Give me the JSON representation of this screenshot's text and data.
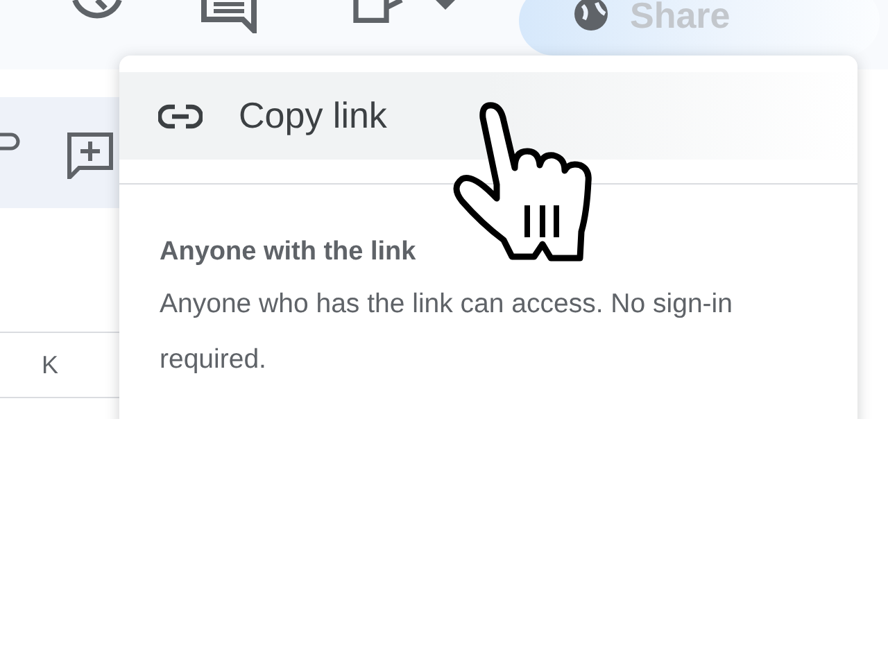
{
  "toolbar": {
    "share_button": {
      "label": "Share"
    }
  },
  "grid": {
    "column_header": "K"
  },
  "share_menu": {
    "items": [
      {
        "label": "Copy link",
        "selected": true
      }
    ],
    "access": {
      "title": "Anyone with the link",
      "description": "Anyone who has the link can access. No sign-in required."
    }
  }
}
